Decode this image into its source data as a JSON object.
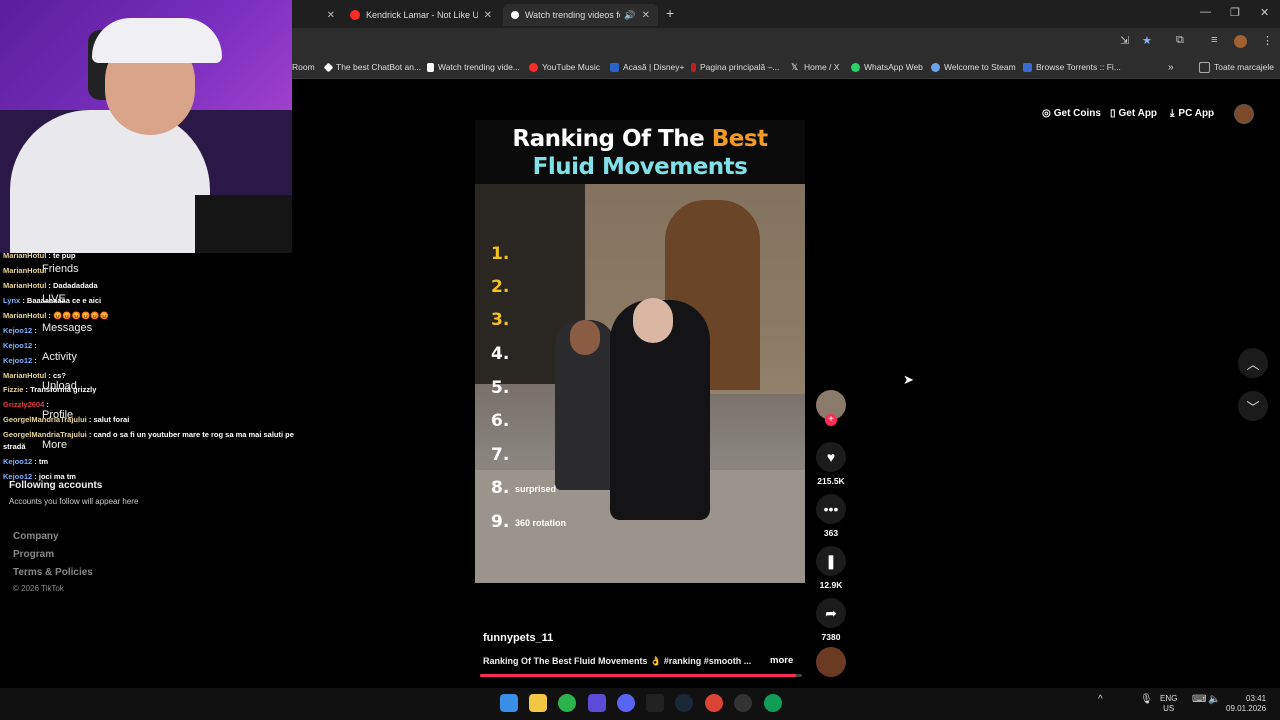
{
  "tabs": [
    {
      "label": "",
      "active": false
    },
    {
      "label": "Kendrick Lamar - Not Like Us -",
      "active": false,
      "color": "#ff2a2a"
    },
    {
      "label": "Watch trending videos for y",
      "active": true,
      "color": "#ffffff"
    }
  ],
  "bookmarks": [
    {
      "label": "Room",
      "color": "#555555"
    },
    {
      "label": "The best ChatBot an...",
      "color": "#ffffff"
    },
    {
      "label": "Watch trending vide...",
      "color": "#ffffff"
    },
    {
      "label": "YouTube Music",
      "color": "#ff2a2a"
    },
    {
      "label": "Acasă | Disney+",
      "color": "#2a64c9"
    },
    {
      "label": "Pagina principală –...",
      "color": "#c21f1f"
    },
    {
      "label": "Home / X",
      "color": "#ffffff"
    },
    {
      "label": "WhatsApp Web",
      "color": "#25d366"
    },
    {
      "label": "Welcome to Steam",
      "color": "#6aa4e8"
    },
    {
      "label": "Browse Torrents :: Fi...",
      "color": "#3b6bd1"
    },
    {
      "label": "Toate marcajele",
      "color": "#999999"
    }
  ],
  "chat": [
    {
      "user": "MarianHotul",
      "msg": "te pup",
      "type": "u"
    },
    {
      "user": "MarianHotul",
      "msg": "",
      "type": "u"
    },
    {
      "user": "MarianHotul",
      "msg": "Dadadadada",
      "type": "u"
    },
    {
      "user": "Lynx",
      "msg": "Baaaaaaaaa ce e aici",
      "type": "u2"
    },
    {
      "user": "MarianHotul",
      "msg": "😡😡😡😡😡😡",
      "type": "u"
    },
    {
      "user": "Kejoo12",
      "msg": "",
      "type": "u2"
    },
    {
      "user": "Kejoo12",
      "msg": "",
      "type": "u2"
    },
    {
      "user": "Kejoo12",
      "msg": "",
      "type": "u2"
    },
    {
      "user": "MarianHotul",
      "msg": "cs?",
      "type": "u"
    },
    {
      "user": "Fizzie",
      "msg": "Transformă grizzly",
      "type": "u"
    },
    {
      "user": "Grizzly2604",
      "msg": "",
      "type": "u3"
    },
    {
      "user": "GeorgelMandriaTrajului",
      "msg": "salut forai",
      "type": "u"
    },
    {
      "user": "GeorgelMandriaTrajului",
      "msg": "cand o sa fi un youtuber mare te rog sa ma mai saluti pe",
      "type": "u"
    },
    {
      "user": "",
      "msg": "stradă",
      "type": "u"
    },
    {
      "user": "Kejoo12",
      "msg": "tm",
      "type": "u2"
    },
    {
      "user": "Kejoo12",
      "msg": "joci ma tm",
      "type": "u2"
    }
  ],
  "sidebar": {
    "nav": [
      "Friends",
      "LIVE",
      "Messages",
      "Activity",
      "Upload",
      "Profile",
      "More"
    ],
    "following_title": "Following accounts",
    "following_empty": "Accounts you follow will appear here",
    "footer": [
      "Company",
      "Program",
      "Terms & Policies"
    ],
    "copyright": "© 2026 TikTok"
  },
  "topbar": {
    "coins": "Get Coins",
    "app": "Get App",
    "pc": "PC App"
  },
  "video": {
    "title_main": "Ranking Of The ",
    "title_highlight": "Best",
    "title_line2": "Fluid Movements",
    "ranks": [
      "1.",
      "2.",
      "3.",
      "4.",
      "5.",
      "6.",
      "7.",
      "8.",
      "9."
    ],
    "rank8_label": "surprised",
    "rank9_label": "360  rotation",
    "author": "funnypets_11",
    "caption": "Ranking Of The Best Fluid Movements 👌 #ranking #smooth ...",
    "more": "more",
    "progress": 0.98
  },
  "actions": {
    "likes": "215.5K",
    "comments": "363",
    "saves": "12.9K",
    "shares": "7380"
  },
  "taskbar": {
    "lang1": "ENG",
    "lang2": "US",
    "time": "03:41",
    "date": "09.01.2026"
  }
}
